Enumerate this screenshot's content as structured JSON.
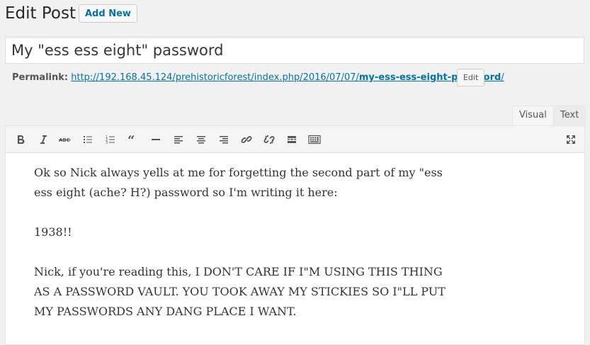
{
  "header": {
    "page_title": "Edit Post",
    "add_new_label": "Add New"
  },
  "post": {
    "title": "My \"ess ess eight\" password",
    "permalink_label": "Permalink:",
    "permalink_base": "http://192.168.45.124/prehistoricforest/index.php/2016/07/07/",
    "permalink_slug": "my-ess-ess-eight-password",
    "permalink_trailing": "/",
    "permalink_edit_label": "Edit"
  },
  "editor": {
    "tabs": [
      {
        "label": "Visual",
        "active": true
      },
      {
        "label": "Text",
        "active": false
      }
    ],
    "toolbar_icons": [
      "bold-icon",
      "italic-icon",
      "strikethrough-icon",
      "bulleted-list-icon",
      "numbered-list-icon",
      "blockquote-icon",
      "horizontal-line-icon",
      "align-left-icon",
      "align-center-icon",
      "align-right-icon",
      "insert-link-icon",
      "remove-link-icon",
      "read-more-icon",
      "toolbar-toggle-icon",
      "fullscreen-icon"
    ],
    "paragraphs": [
      "Ok so Nick always yells at me for forgetting the second part of my \"ess ess eight (ache? H?) password so I'm writing it here:",
      "1938!!",
      "Nick, if you're reading this, I DON'T CARE IF I\"M USING THIS THING AS A PASSWORD VAULT. YOU TOOK AWAY MY STICKIES SO I\"LL PUT MY PASSWORDS ANY DANG PLACE I WANT."
    ]
  },
  "colors": {
    "link": "#0073aa",
    "background": "#f1f1f1",
    "toolbar_bg": "#f5f5f5",
    "icon": "#555555"
  }
}
